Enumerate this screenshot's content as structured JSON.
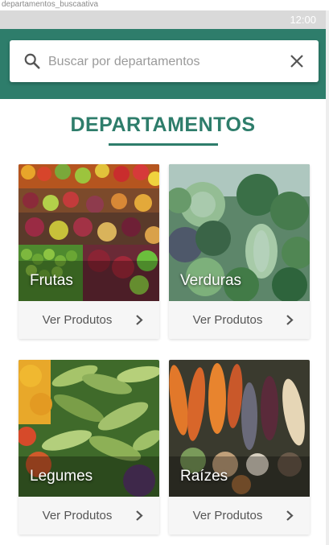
{
  "artboard_label": "departamentos_buscaativa",
  "status_bar": {
    "time": "12:00"
  },
  "search": {
    "placeholder": "Buscar por departamentos",
    "value": ""
  },
  "section": {
    "title": "DEPARTAMENTOS"
  },
  "departments": [
    {
      "label": "Frutas",
      "action": "Ver Produtos"
    },
    {
      "label": "Verduras",
      "action": "Ver Produtos"
    },
    {
      "label": "Legumes",
      "action": "Ver Produtos"
    },
    {
      "label": "Raízes",
      "action": "Ver Produtos"
    }
  ],
  "colors": {
    "primary": "#2e7d6b",
    "status_bar": "#d9d9d9",
    "footer": "#f6f6f6"
  },
  "icons": {
    "search": "search-icon",
    "close": "close-icon",
    "chevron": "chevron-right-icon"
  }
}
